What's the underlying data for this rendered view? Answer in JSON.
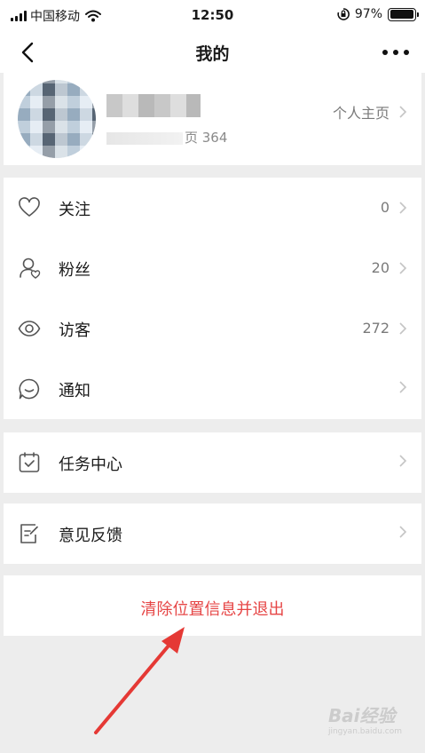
{
  "status_bar": {
    "carrier": "中国移动",
    "time": "12:50",
    "battery": "97%",
    "battery_level": 0.97
  },
  "nav": {
    "title": "我的"
  },
  "profile": {
    "sub_suffix": "页 364",
    "home_label": "个人主页"
  },
  "menu": {
    "follow": {
      "label": "关注",
      "value": "0",
      "icon": "heart-icon"
    },
    "fans": {
      "label": "粉丝",
      "value": "20",
      "icon": "user-heart-icon"
    },
    "visitors": {
      "label": "访客",
      "value": "272",
      "icon": "eye-icon"
    },
    "notify": {
      "label": "通知",
      "value": "",
      "icon": "chat-bubble-icon"
    },
    "tasks": {
      "label": "任务中心",
      "value": "",
      "icon": "calendar-check-icon"
    },
    "feedback": {
      "label": "意见反馈",
      "value": "",
      "icon": "edit-note-icon"
    }
  },
  "logout": {
    "label": "清除位置信息并退出",
    "color": "#e64545"
  },
  "watermark": {
    "brand": "Bai",
    "brand_suffix": "经验",
    "url": "jingyan.baidu.com"
  },
  "colors": {
    "background": "#ededed",
    "annotation_arrow": "#e53935"
  }
}
